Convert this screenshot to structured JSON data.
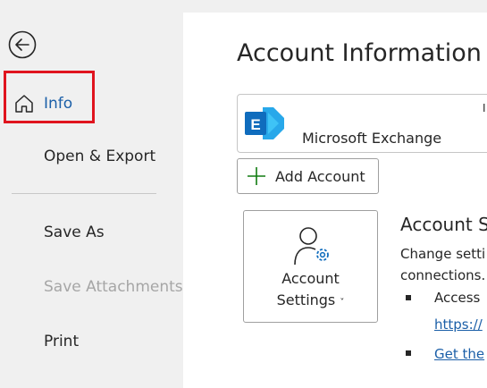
{
  "sidebar": {
    "items": [
      {
        "label": "Info",
        "active": true
      },
      {
        "label": "Open & Export"
      },
      {
        "label": "Save As"
      },
      {
        "label": "Save Attachments",
        "disabled": true
      },
      {
        "label": "Print"
      }
    ]
  },
  "main": {
    "title": "Account Information",
    "account": {
      "name": "Microsoft Exchange",
      "sub_glyph": "I"
    },
    "add_account_label": "Add Account",
    "settings_button": {
      "line1": "Account",
      "line2": "Settings",
      "chevron": "˅"
    },
    "section_title": "Account S",
    "description": {
      "line1": "Change setti",
      "line2": "connections."
    },
    "bullets": [
      {
        "text": "Access",
        "link": "https://"
      },
      {
        "link": "Get the"
      }
    ]
  },
  "colors": {
    "accent": "#1b5fa8",
    "highlight_border": "#e0141e",
    "sidebar_bg": "#f0f0f0",
    "exchange_blue": "#0f6cbd",
    "exchange_light": "#28a8ea",
    "add_green": "#107c10"
  }
}
